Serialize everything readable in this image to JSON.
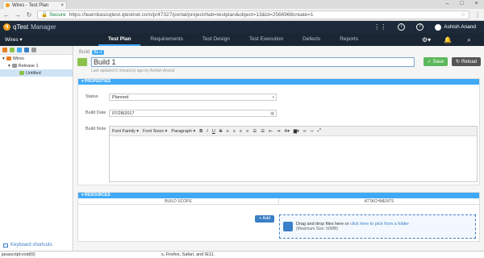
{
  "browser": {
    "tab_title": "Wires - Test Plan",
    "secure_label": "Secure",
    "url": "https://learnbasicqtest.qtestnet.com/p/47327/portal/project#tab=testplan&object=13&id=2566968create=1"
  },
  "app": {
    "product_name": "Manager",
    "user_name": "Ashish Anand",
    "notification_count": ""
  },
  "nav": {
    "project": "Wires",
    "tabs": [
      "Test Plan",
      "Requirements",
      "Test Design",
      "Test Execution",
      "Defects",
      "Reports"
    ]
  },
  "tree": {
    "root": "Wires",
    "release": "Release 1",
    "item": "Untitled"
  },
  "keyboard_shortcuts": "Keyboard shortcuts",
  "build": {
    "label": "Build",
    "badge": "BL-1",
    "name": "Build 1",
    "updated": "Last updated 0 minute(s) ago by Ashish Anand"
  },
  "buttons": {
    "save": "Save",
    "reload": "Reload"
  },
  "properties": {
    "header": "PROPERTIES",
    "status_label": "Status",
    "status_value": "Planned",
    "date_label": "Build Date",
    "date_value": "07/28/2017",
    "note_label": "Build Note"
  },
  "editor": {
    "font_family": "Font Family",
    "font_sizes": "Font Sizes",
    "paragraph": "Paragraph"
  },
  "resources": {
    "header": "RESOURCES",
    "col_scope": "BUILD SCOPE",
    "col_attach": "ATTACHMENTS",
    "add_label": "+ Add",
    "drop_text": "Drag and drop files here or",
    "drop_link": "click here to pick from a folder",
    "drop_size": "(Maximum Size: 50MB)"
  },
  "statusbar": "javascript:void(0)",
  "statusbar_right": "s, Firefox, Safari, and IE11."
}
